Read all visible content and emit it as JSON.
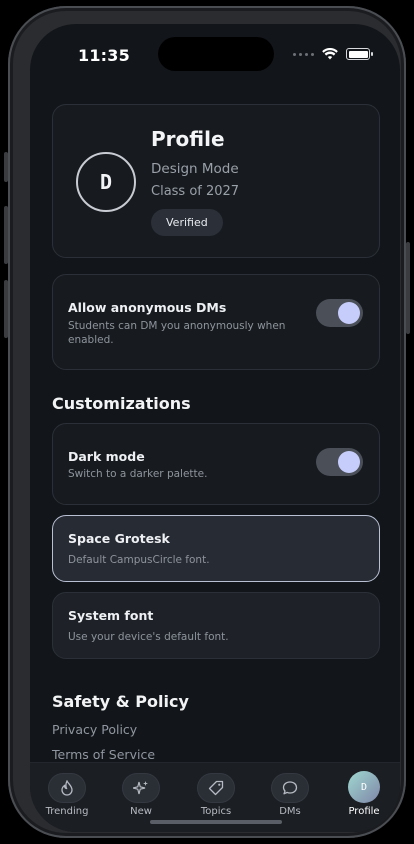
{
  "status_bar": {
    "time": "11:35"
  },
  "profile": {
    "avatar_letter": "D",
    "title": "Profile",
    "name": "Design Mode",
    "class_year": "Class of 2027",
    "badge": "Verified"
  },
  "anonymous_dms": {
    "title": "Allow anonymous DMs",
    "description": "Students can DM you anonymously when enabled.",
    "enabled": true
  },
  "customizations": {
    "heading": "Customizations",
    "dark_mode": {
      "title": "Dark mode",
      "description": "Switch to a darker palette.",
      "enabled": true
    },
    "fonts": [
      {
        "title": "Space Grotesk",
        "description": "Default CampusCircle font.",
        "selected": true
      },
      {
        "title": "System font",
        "description": "Use your device's default font.",
        "selected": false
      }
    ]
  },
  "safety": {
    "heading": "Safety & Policy",
    "links": [
      "Privacy Policy",
      "Terms of Service"
    ]
  },
  "tabbar": {
    "tabs": [
      {
        "label": "Trending",
        "icon": "flame-icon"
      },
      {
        "label": "New",
        "icon": "sparkles-icon"
      },
      {
        "label": "Topics",
        "icon": "tag-icon"
      },
      {
        "label": "DMs",
        "icon": "chat-bubble-icon"
      },
      {
        "label": "Profile",
        "icon": "avatar",
        "avatar_letter": "D",
        "active": true
      }
    ]
  },
  "colors": {
    "background": "#121519",
    "card": "#171b20",
    "accent_toggle_knob": "#c6cdfb",
    "selected_border": "#b9c0d4"
  }
}
